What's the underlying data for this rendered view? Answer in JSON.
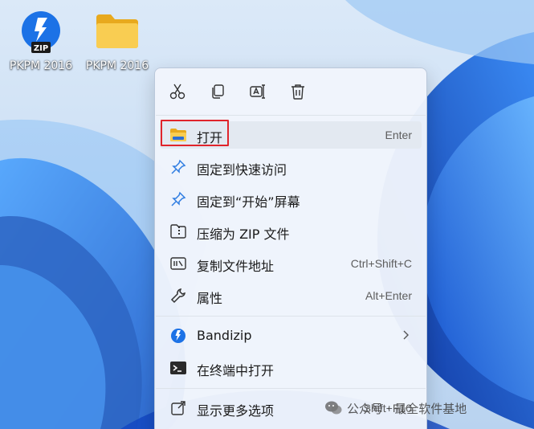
{
  "desktop": {
    "icons": [
      {
        "label": "PKPM 2016",
        "icon": "bandizip-zip-icon"
      },
      {
        "label": "PKPM 2016",
        "icon": "folder-icon"
      }
    ]
  },
  "menu": {
    "toolbar": [
      {
        "icon": "cut-icon",
        "name": "cut"
      },
      {
        "icon": "copy-icon",
        "name": "copy"
      },
      {
        "icon": "rename-icon",
        "name": "rename"
      },
      {
        "icon": "delete-icon",
        "name": "delete"
      }
    ],
    "items": [
      {
        "label": "打开",
        "shortcut": "Enter",
        "icon": "folder-open-icon"
      },
      {
        "label": "固定到快速访问",
        "shortcut": "",
        "icon": "pin-icon"
      },
      {
        "label": "固定到“开始”屏幕",
        "shortcut": "",
        "icon": "pin-icon"
      },
      {
        "label": "压缩为 ZIP 文件",
        "shortcut": "",
        "icon": "zip-folder-icon"
      },
      {
        "label": "复制文件地址",
        "shortcut": "Ctrl+Shift+C",
        "icon": "copy-path-icon"
      },
      {
        "label": "属性",
        "shortcut": "Alt+Enter",
        "icon": "wrench-icon"
      },
      {
        "label": "Bandizip",
        "shortcut": "",
        "icon": "bandizip-icon",
        "submenu": true
      },
      {
        "label": "在终端中打开",
        "shortcut": "",
        "icon": "terminal-icon"
      },
      {
        "label": "显示更多选项",
        "shortcut": "Shift+F10",
        "icon": "more-options-icon"
      }
    ]
  },
  "watermark": {
    "text": "公众号 · 最全软件基地",
    "icon": "wechat-icon"
  },
  "colors": {
    "highlight": "#e0242b",
    "wallpaper_blue": "#1f6fe0",
    "folder_yellow": "#f5c242"
  }
}
